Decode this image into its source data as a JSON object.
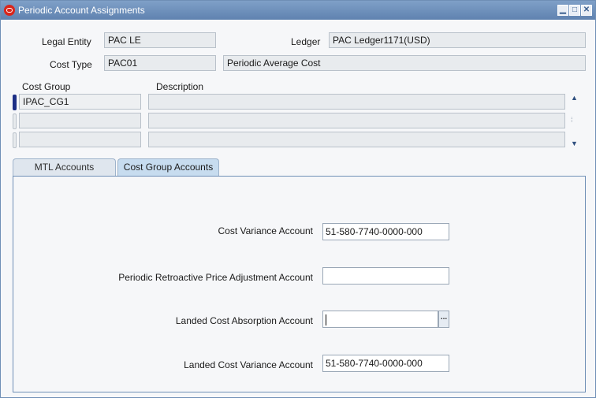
{
  "window": {
    "title": "Periodic Account Assignments",
    "icons": {
      "app": "oracle-logo-icon",
      "minimize": "minimize-icon",
      "maximize": "maximize-icon",
      "close": "close-icon"
    },
    "glyphs": {
      "minimize": "▁",
      "maximize": "□",
      "close": "✕"
    }
  },
  "header": {
    "legal_entity_label": "Legal Entity",
    "legal_entity_value": "PAC LE",
    "ledger_label": "Ledger",
    "ledger_value": "PAC Ledger1171(USD)",
    "cost_type_label": "Cost Type",
    "cost_type_value": "PAC01",
    "cost_type_description": "Periodic Average Cost"
  },
  "cost_groups": {
    "columns": [
      "Cost Group",
      "Description"
    ],
    "rows": [
      {
        "cost_group": "IPAC_CG1",
        "description": ""
      },
      {
        "cost_group": "",
        "description": ""
      },
      {
        "cost_group": "",
        "description": ""
      }
    ]
  },
  "tabs": [
    {
      "label": "MTL Accounts",
      "active": false
    },
    {
      "label": "Cost Group Accounts",
      "active": true
    }
  ],
  "accounts": {
    "cost_variance_label": "Cost Variance Account",
    "cost_variance_value": "51-580-7740-0000-000",
    "periodic_retro_label": "Periodic Retroactive Price Adjustment Account",
    "periodic_retro_value": "",
    "landed_absorption_label": "Landed Cost Absorption Account",
    "landed_absorption_value": "",
    "landed_variance_label": "Landed Cost Variance Account",
    "landed_variance_value": "51-580-7740-0000-000",
    "lov_button_label": "..."
  },
  "colors": {
    "titlebar": "#6a8cb8",
    "active_tab": "#c7dcef",
    "active_row_indicator": "#1d2f86"
  }
}
